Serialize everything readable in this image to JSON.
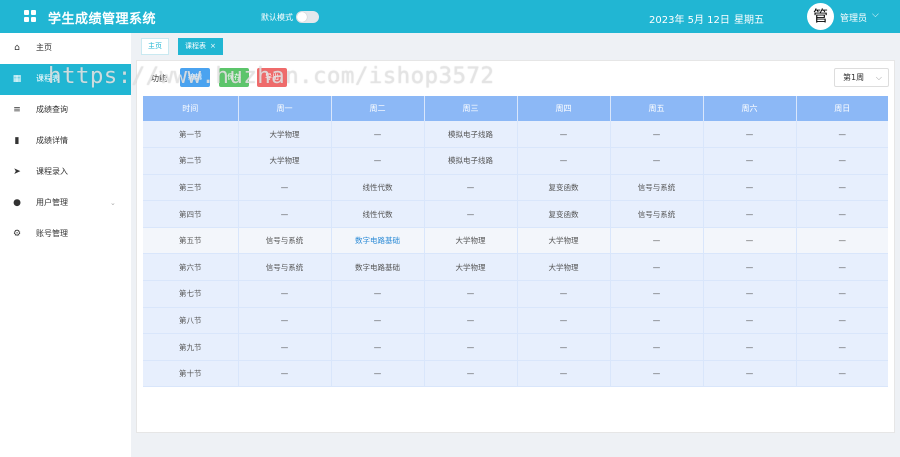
{
  "header": {
    "title": "学生成绩管理系统",
    "mode_label": "默认模式",
    "date": "2023年 5月 12日",
    "weekday": "星期五",
    "avatar_char": "管",
    "user_name": "管理员",
    "user_caret": "⌵"
  },
  "sidebar": {
    "items": [
      {
        "label": "主页",
        "icon": "home-icon",
        "glyph": "⌂"
      },
      {
        "label": "课程表",
        "icon": "grid-icon",
        "glyph": "▦"
      },
      {
        "label": "成绩查询",
        "icon": "list-icon",
        "glyph": "≡"
      },
      {
        "label": "成绩详情",
        "icon": "bar-chart-icon",
        "glyph": "▮"
      },
      {
        "label": "课程录入",
        "icon": "send-icon",
        "glyph": "➤"
      },
      {
        "label": "用户管理",
        "icon": "user-icon",
        "glyph": "●"
      },
      {
        "label": "账号管理",
        "icon": "gear-icon",
        "glyph": "⚙"
      }
    ],
    "user_caret": "⌄"
  },
  "tabs": [
    {
      "label": "主页"
    },
    {
      "label": "课程表",
      "close": "×"
    }
  ],
  "toolbar": {
    "label": "功能",
    "buttons": [
      {
        "label": "编辑",
        "color": "#4aa3f0"
      },
      {
        "label": "保存",
        "color": "#5cc56b"
      },
      {
        "label": "导出",
        "color": "#ef6b6b"
      }
    ],
    "week_select": "第1周",
    "week_caret": "⌵"
  },
  "timetable": {
    "headers": [
      "时间",
      "周一",
      "周二",
      "周三",
      "周四",
      "周五",
      "周六",
      "周日"
    ],
    "rows": [
      [
        "第一节",
        "大学物理",
        "—",
        "模拟电子线路",
        "—",
        "—",
        "—",
        "—"
      ],
      [
        "第二节",
        "大学物理",
        "—",
        "模拟电子线路",
        "—",
        "—",
        "—",
        "—"
      ],
      [
        "第三节",
        "—",
        "线性代数",
        "—",
        "复变函数",
        "信号与系统",
        "—",
        "—"
      ],
      [
        "第四节",
        "—",
        "线性代数",
        "—",
        "复变函数",
        "信号与系统",
        "—",
        "—"
      ],
      [
        "第五节",
        "信号与系统",
        "数字电路基础",
        "大学物理",
        "大学物理",
        "—",
        "—",
        "—"
      ],
      [
        "第六节",
        "信号与系统",
        "数字电路基础",
        "大学物理",
        "大学物理",
        "—",
        "—",
        "—"
      ],
      [
        "第七节",
        "—",
        "—",
        "—",
        "—",
        "—",
        "—",
        "—"
      ],
      [
        "第八节",
        "—",
        "—",
        "—",
        "—",
        "—",
        "—",
        "—"
      ],
      [
        "第九节",
        "—",
        "—",
        "—",
        "—",
        "—",
        "—",
        "—"
      ],
      [
        "第十节",
        "—",
        "—",
        "—",
        "—",
        "—",
        "—",
        "—"
      ]
    ]
  },
  "watermark": "https://www.huzhan.com/ishop3572",
  "colors": {
    "accent": "#21b6d3",
    "table_header": "#8cb8f6",
    "row_fill": "#e7effd",
    "link": "#2c8bd6"
  }
}
